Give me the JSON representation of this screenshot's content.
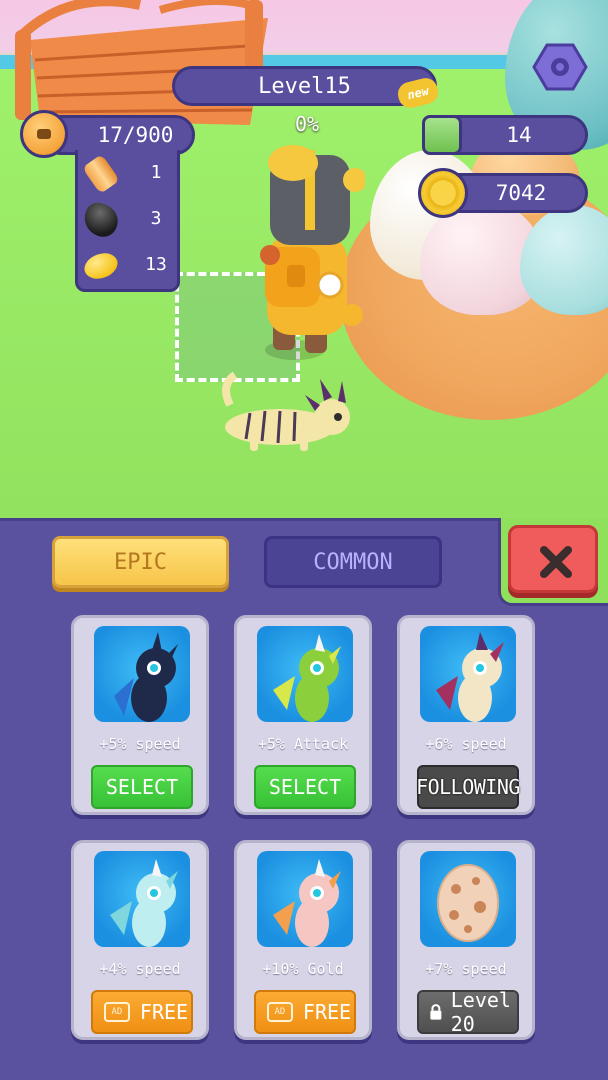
{
  "hud": {
    "level_label": "Level15",
    "new_badge": "new",
    "progress_percent": "0%",
    "bag_capacity": "17/900",
    "gems": "14",
    "coins": "7042",
    "resources": [
      {
        "icon": "wood-log-icon",
        "count": "1"
      },
      {
        "icon": "coal-icon",
        "count": "3"
      },
      {
        "icon": "gold-ore-icon",
        "count": "13"
      }
    ]
  },
  "tabs": {
    "epic": "EPIC",
    "common": "COMMON"
  },
  "pets": [
    {
      "perk": "+5% speed",
      "button": "SELECT",
      "state": "select",
      "color": "#1f2a4a",
      "accent": "#2b6fd1"
    },
    {
      "perk": "+5% Attack",
      "button": "SELECT",
      "state": "select",
      "color": "#8ccf3c",
      "accent": "#d8e84a"
    },
    {
      "perk": "+6% speed",
      "button": "FOLLOWING",
      "state": "following",
      "color": "#f3e6c7",
      "accent": "#a3305e"
    },
    {
      "perk": "+4% speed",
      "button": "FREE",
      "ad_label": "AD",
      "state": "free",
      "color": "#bfeef0",
      "accent": "#7fd6dc"
    },
    {
      "perk": "+10% Gold",
      "button": "FREE",
      "ad_label": "AD",
      "state": "free",
      "color": "#f6c6c2",
      "accent": "#f29f4e"
    },
    {
      "perk": "+7% speed",
      "button": "Level 20",
      "state": "locked",
      "color": "#f1d2b8",
      "accent": "#c98457"
    }
  ],
  "colors": {
    "panel": "#5a529e",
    "select_green": "#39c137",
    "free_orange": "#f08f14",
    "close_red": "#f05b5b"
  }
}
